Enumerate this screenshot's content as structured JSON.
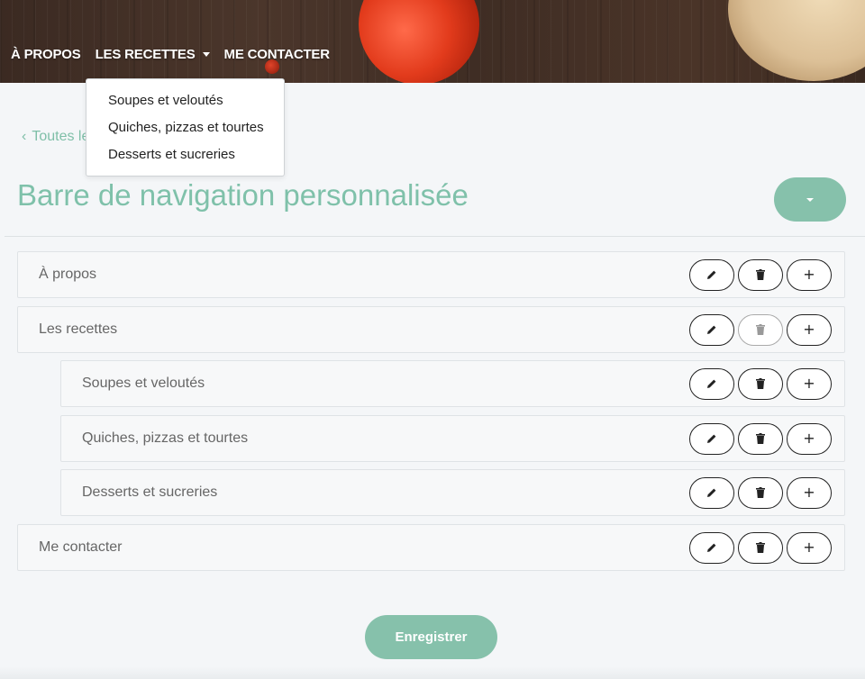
{
  "topnav": {
    "items": [
      {
        "label": "À PROPOS"
      },
      {
        "label": "LES RECETTES",
        "has_dropdown": true
      },
      {
        "label": "ME CONTACTER"
      }
    ]
  },
  "dropdown": {
    "items": [
      {
        "label": "Soupes et veloutés"
      },
      {
        "label": "Quiches, pizzas et tourtes"
      },
      {
        "label": "Desserts et sucreries"
      }
    ]
  },
  "back_link": {
    "chevron": "‹",
    "label": "Toutes les"
  },
  "page_title": "Barre de navigation personnalisée",
  "menu_rows": [
    {
      "label": "À propos",
      "level": 0,
      "delete_enabled": true
    },
    {
      "label": "Les recettes",
      "level": 0,
      "delete_enabled": false
    },
    {
      "label": "Soupes et veloutés",
      "level": 1,
      "delete_enabled": true
    },
    {
      "label": "Quiches, pizzas et tourtes",
      "level": 1,
      "delete_enabled": true
    },
    {
      "label": "Desserts et sucreries",
      "level": 1,
      "delete_enabled": true
    },
    {
      "label": "Me contacter",
      "level": 0,
      "delete_enabled": true
    }
  ],
  "row_icons": {
    "edit": "pencil-icon",
    "delete": "trash-icon",
    "add": "plus-icon",
    "add_glyph": "+"
  },
  "save_label": "Enregistrer",
  "colors": {
    "accent": "#86c1ab",
    "title": "#7fc1aa"
  }
}
